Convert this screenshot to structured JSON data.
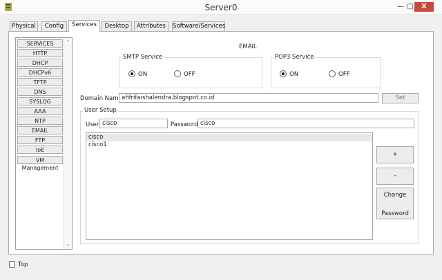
{
  "window": {
    "title": "Server0",
    "min_label": "—",
    "max_label": "□",
    "close_label": "X"
  },
  "tabs": [
    {
      "label": "Physical"
    },
    {
      "label": "Config"
    },
    {
      "label": "Services",
      "active": true
    },
    {
      "label": "Desktop"
    },
    {
      "label": "Attributes"
    },
    {
      "label": "Software/Services"
    }
  ],
  "services": [
    "SERVICES",
    "HTTP",
    "DHCP",
    "DHCPv6",
    "TFTP",
    "DNS",
    "SYSLOG",
    "AAA",
    "NTP",
    "EMAIL",
    "FTP",
    "IoE",
    "VM Management"
  ],
  "email": {
    "heading": "EMAIL",
    "smtp": {
      "legend": "SMTP Service",
      "on_label": "ON",
      "off_label": "OFF",
      "selected": "ON"
    },
    "pop3": {
      "legend": "POP3 Service",
      "on_label": "ON",
      "off_label": "OFF",
      "selected": "ON"
    },
    "domain_label": "Domain Name:",
    "domain_value": "afifrifaishalendra.blogspot.co.id",
    "set_label": "Set",
    "user_setup": {
      "legend": "User Setup",
      "user_label": "User",
      "user_value": "cisco",
      "password_label": "Password",
      "password_value": "cisco",
      "users": [
        "cisco",
        "cisco1"
      ],
      "add_label": "+",
      "remove_label": "-",
      "change_label_1": "Change",
      "change_label_2": "Password"
    }
  },
  "footer": {
    "top_label": "Top",
    "top_checked": false
  }
}
